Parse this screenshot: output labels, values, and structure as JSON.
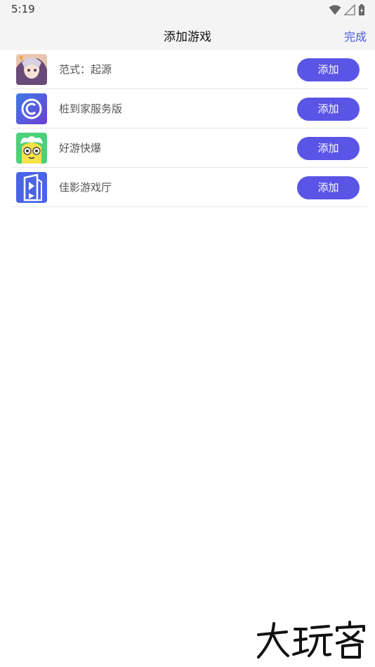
{
  "status": {
    "time": "5:19"
  },
  "header": {
    "title": "添加游戏",
    "done_label": "完成"
  },
  "games": [
    {
      "name": "范式：起源",
      "icon": "anime-character-icon",
      "button": "添加"
    },
    {
      "name": "桩到家服务版",
      "icon": "c-logo-icon",
      "button": "添加"
    },
    {
      "name": "好游快爆",
      "icon": "cartoon-face-icon",
      "button": "添加"
    },
    {
      "name": "佳影游戏厅",
      "icon": "building-logo-icon",
      "button": "添加"
    }
  ],
  "watermark": {
    "text": "大玩客"
  },
  "colors": {
    "accent": "#5a55e6",
    "link": "#4a5ae6"
  }
}
